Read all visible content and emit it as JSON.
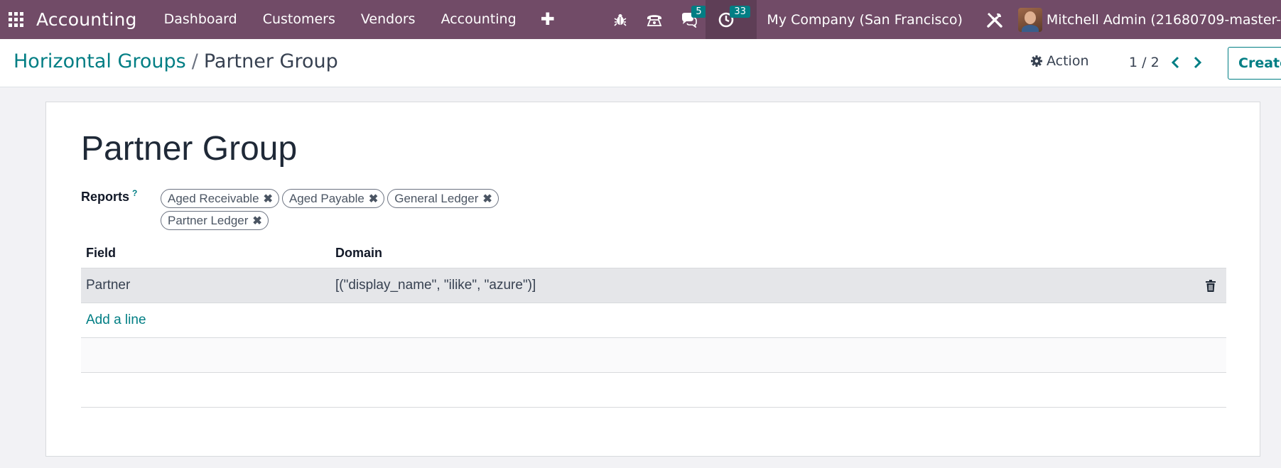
{
  "navbar": {
    "brand": "Accounting",
    "menu": [
      "Dashboard",
      "Customers",
      "Vendors",
      "Accounting"
    ],
    "plus_icon": "plus-icon",
    "messages_count": "5",
    "activities_count": "33",
    "company": "My Company (San Francisco)",
    "user": "Mitchell Admin (21680709-master-"
  },
  "control": {
    "breadcrumb_parent": "Horizontal Groups",
    "breadcrumb_sep": "/",
    "breadcrumb_current": "Partner Group",
    "action_label": "Action",
    "pager": "1 / 2",
    "create_label": "Create"
  },
  "form": {
    "title": "Partner Group",
    "reports_label": "Reports",
    "help_mark": "?",
    "reports": [
      "Aged Receivable",
      "Aged Payable",
      "General Ledger",
      "Partner Ledger"
    ],
    "table": {
      "headers": {
        "field": "Field",
        "domain": "Domain"
      },
      "rows": [
        {
          "field": "Partner",
          "domain": "[(\"display_name\", \"ilike\", \"azure\")]"
        }
      ],
      "add_line": "Add a line"
    }
  },
  "colors": {
    "navbar": "#714b67",
    "accent": "#017e84",
    "row_selected": "#e5e6e9"
  }
}
